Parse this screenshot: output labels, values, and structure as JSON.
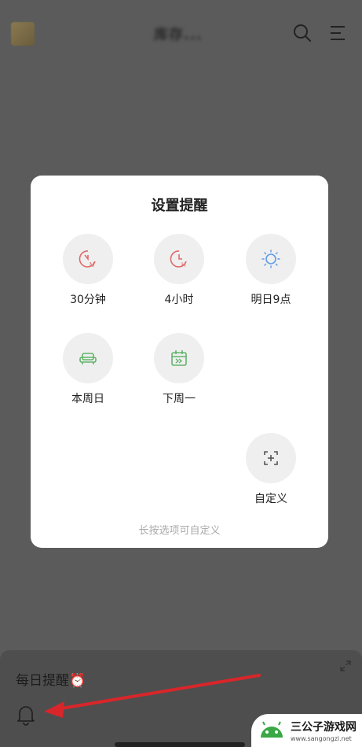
{
  "topbar": {
    "title": "库存...",
    "icons": [
      "search-icon",
      "menu-icon"
    ]
  },
  "modal": {
    "title": "设置提醒",
    "options": [
      {
        "label": "30分钟",
        "icon": "clock-minutes-icon",
        "color": "#e06a6a"
      },
      {
        "label": "4小时",
        "icon": "clock-hours-icon",
        "color": "#e06a6a"
      },
      {
        "label": "明日9点",
        "icon": "sun-icon",
        "color": "#5b9ce6"
      },
      {
        "label": "本周日",
        "icon": "sofa-icon",
        "color": "#62b36b"
      },
      {
        "label": "下周一",
        "icon": "calendar-next-icon",
        "color": "#62b36b"
      },
      {
        "label": "自定义",
        "icon": "custom-add-icon",
        "color": "#555555"
      }
    ],
    "hint": "长按选项可自定义"
  },
  "panel": {
    "title": "每日提醒",
    "emoji": "⏰"
  },
  "watermark": {
    "name": "三公子游戏网",
    "url": "www.sangongzi.net"
  }
}
